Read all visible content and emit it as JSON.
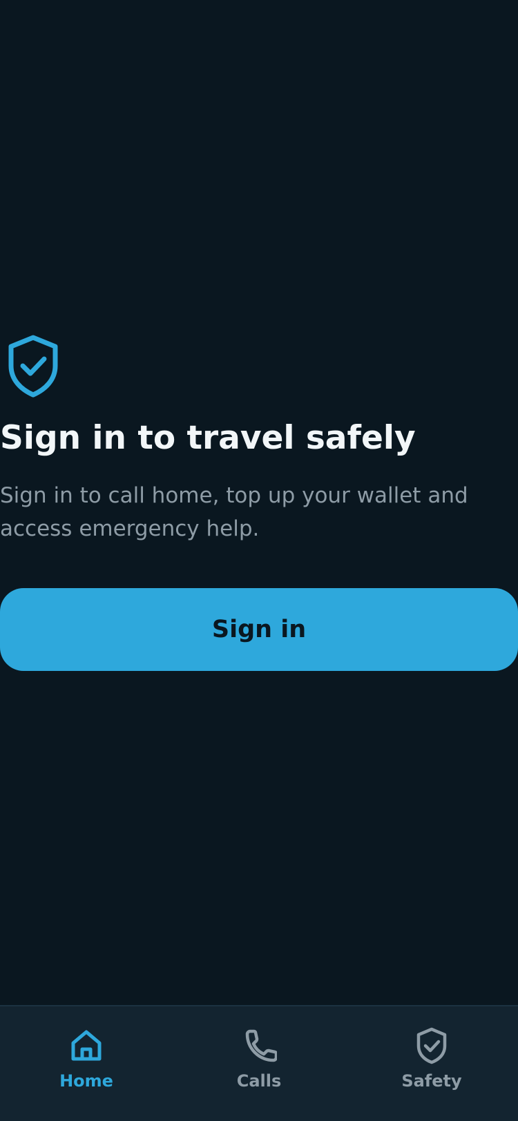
{
  "colors": {
    "background": "#0a1720",
    "accent": "#2ea8dc",
    "tabbar_background": "#132430",
    "title_text": "#f2f6f8",
    "muted_text": "#8e9ca6"
  },
  "hero": {
    "icon": "shield-check-icon",
    "title": "Sign in to travel safely",
    "subtitle": "Sign in to call home, top up your wallet and access emergency help.",
    "button_label": "Sign in"
  },
  "tabbar": {
    "active": "Home",
    "items": [
      {
        "label": "Home",
        "icon": "home-icon"
      },
      {
        "label": "Calls",
        "icon": "phone-icon"
      },
      {
        "label": "Safety",
        "icon": "shield-check-icon"
      }
    ]
  }
}
